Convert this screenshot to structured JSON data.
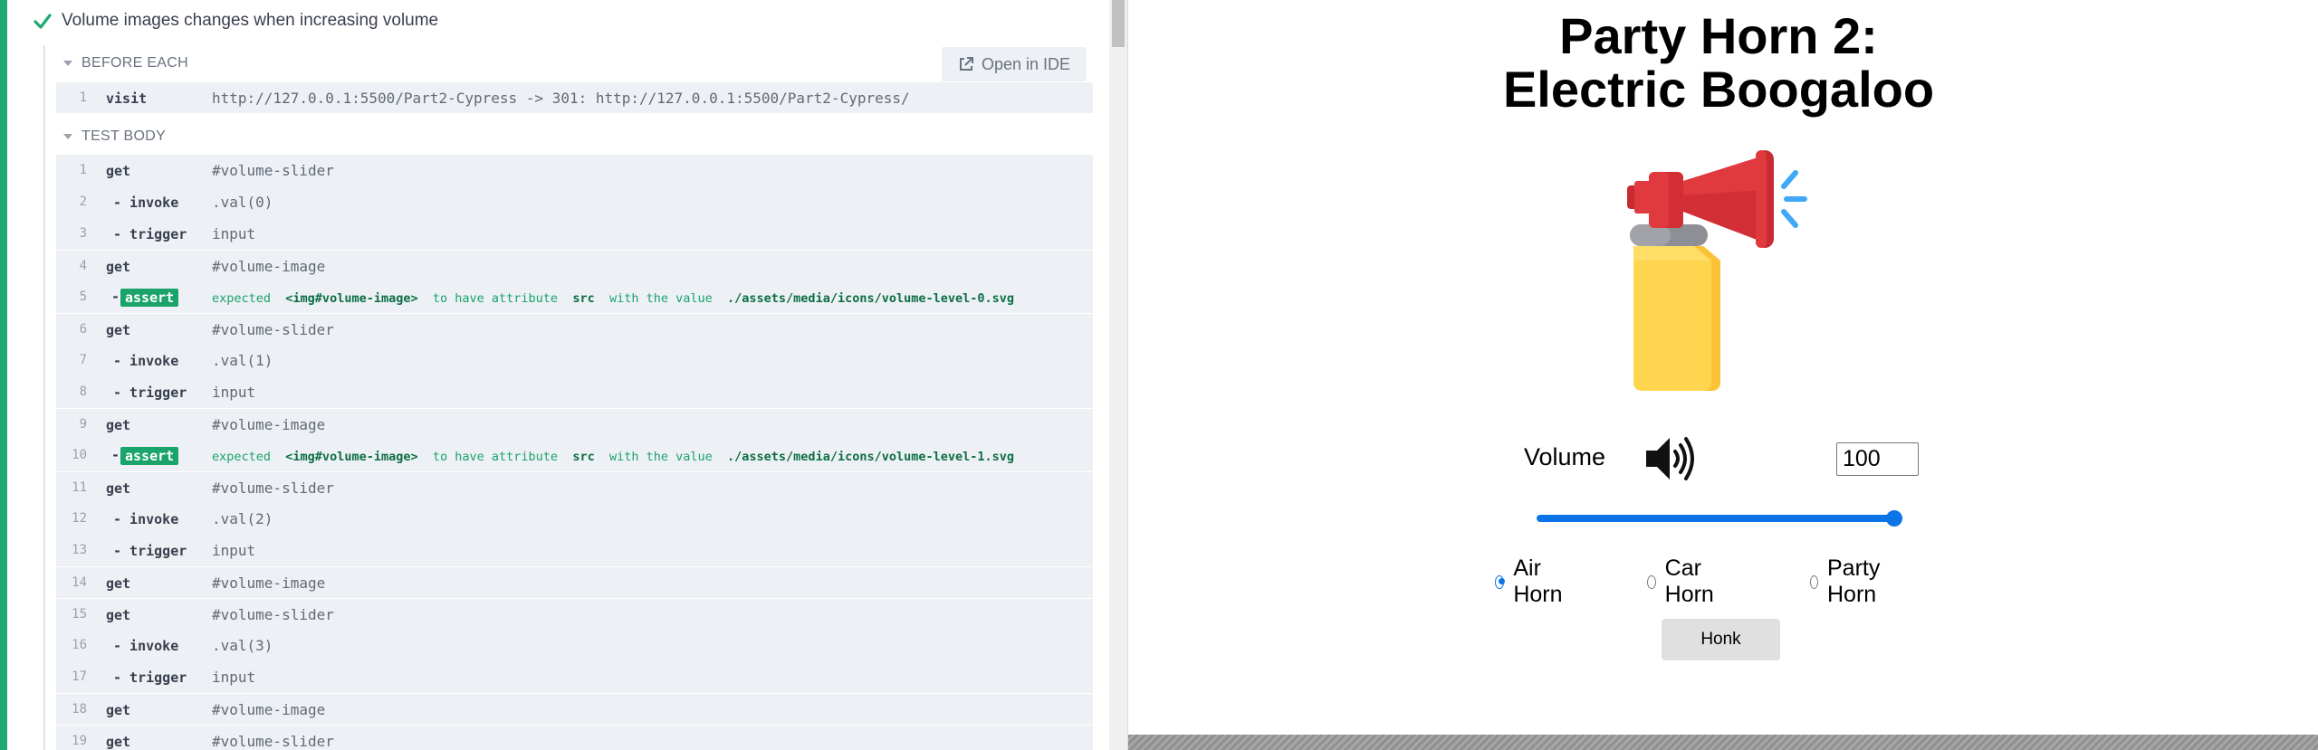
{
  "runner": {
    "test_title": "Volume images changes when increasing volume",
    "open_in_ide_label": "Open in IDE",
    "before_each": {
      "label": "BEFORE EACH",
      "commands": [
        {
          "num": "1",
          "name": "visit",
          "message": "http://127.0.0.1:5500/Part2-Cypress -> 301: http://127.0.0.1:5500/Part2-Cypress/"
        }
      ]
    },
    "test_body": {
      "label": "TEST BODY",
      "commands": [
        {
          "num": "1",
          "name": "get",
          "message": "#volume-slider"
        },
        {
          "num": "2",
          "name": "- invoke",
          "message": ".val(0)"
        },
        {
          "num": "3",
          "name": "- trigger",
          "message": "input"
        },
        {
          "num": "4",
          "name": "get",
          "message": "#volume-image"
        },
        {
          "num": "5",
          "name": "assert",
          "dash": "-",
          "expected": "expected",
          "subject": "<img#volume-image>",
          "phrase": "to have attribute",
          "attr": "src",
          "with": "with the value",
          "value": "./assets/media/icons/volume-level-0.svg"
        },
        {
          "num": "6",
          "name": "get",
          "message": "#volume-slider"
        },
        {
          "num": "7",
          "name": "- invoke",
          "message": ".val(1)"
        },
        {
          "num": "8",
          "name": "- trigger",
          "message": "input"
        },
        {
          "num": "9",
          "name": "get",
          "message": "#volume-image"
        },
        {
          "num": "10",
          "name": "assert",
          "dash": "-",
          "expected": "expected",
          "subject": "<img#volume-image>",
          "phrase": "to have attribute",
          "attr": "src",
          "with": "with the value",
          "value": "./assets/media/icons/volume-level-1.svg"
        },
        {
          "num": "11",
          "name": "get",
          "message": "#volume-slider"
        },
        {
          "num": "12",
          "name": "- invoke",
          "message": ".val(2)"
        },
        {
          "num": "13",
          "name": "- trigger",
          "message": "input"
        },
        {
          "num": "14",
          "name": "get",
          "message": "#volume-image"
        },
        {
          "num": "15",
          "name": "get",
          "message": "#volume-slider"
        },
        {
          "num": "16",
          "name": "- invoke",
          "message": ".val(3)"
        },
        {
          "num": "17",
          "name": "- trigger",
          "message": "input"
        },
        {
          "num": "18",
          "name": "get",
          "message": "#volume-image"
        },
        {
          "num": "19",
          "name": "get",
          "message": "#volume-slider"
        }
      ]
    }
  },
  "app": {
    "title_line1": "Party Horn 2:",
    "title_line2": "Electric Boogaloo",
    "volume_label": "Volume",
    "volume_value": "100",
    "slider_value": 100,
    "horn_options": [
      {
        "label": "Air Horn",
        "selected": true
      },
      {
        "label": "Car Horn",
        "selected": false
      },
      {
        "label": "Party Horn",
        "selected": false
      }
    ],
    "honk_label": "Honk"
  },
  "colors": {
    "pass_green": "#1fa971",
    "assert_green": "#1aa36b",
    "slider_blue": "#0b74e6",
    "command_bg": "#edf0f4",
    "horn_red": "#e0393e",
    "horn_yellow": "#ffd54f"
  }
}
